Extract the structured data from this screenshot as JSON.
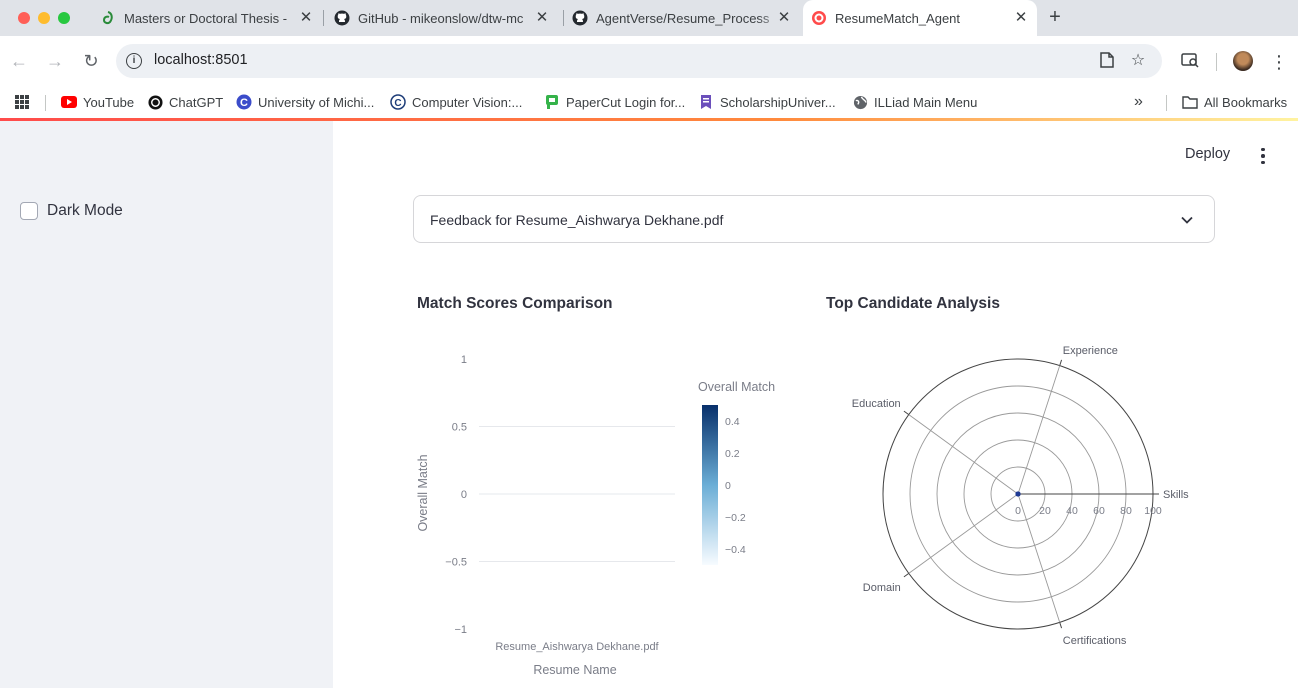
{
  "browser": {
    "tabs": [
      {
        "title": "Masters or Doctoral Thesis - ",
        "icon": "overleaf-icon",
        "active": false
      },
      {
        "title": "GitHub - mikeonslow/dtw-mc",
        "icon": "github-icon",
        "active": false
      },
      {
        "title": "AgentVerse/Resume_Process",
        "icon": "github-icon",
        "active": false
      },
      {
        "title": "ResumeMatch_Agent",
        "icon": "streamlit-icon",
        "active": true
      }
    ],
    "url": "localhost:8501",
    "bookmarks": [
      {
        "label": "YouTube",
        "icon": "youtube-icon"
      },
      {
        "label": "ChatGPT",
        "icon": "chatgpt-icon"
      },
      {
        "label": "University of Michi...",
        "icon": "umich-icon"
      },
      {
        "label": "Computer Vision:...",
        "icon": "cv-icon"
      },
      {
        "label": "PaperCut Login for...",
        "icon": "papercut-icon"
      },
      {
        "label": "ScholarshipUniver...",
        "icon": "scholarship-icon"
      },
      {
        "label": "ILLiad Main Menu",
        "icon": "globe-icon"
      }
    ],
    "all_bookmarks": "All Bookmarks",
    "chevron_more": "»"
  },
  "sidebar": {
    "dark_mode_label": "Dark Mode",
    "dark_mode_checked": false
  },
  "header": {
    "deploy_label": "Deploy"
  },
  "expander": {
    "label": "Feedback for Resume_Aishwarya Dekhane.pdf"
  },
  "bar_chart_title": "Match Scores Comparison",
  "radar_chart_title": "Top Candidate Analysis",
  "colors": {
    "accent": "#ff4b4b",
    "text": "#31333f",
    "sidebar_bg": "#f0f2f6",
    "colorscale_low": "#f7fbff",
    "colorscale_mid": "#6baed6",
    "colorscale_high": "#08306b",
    "radar_point": "#1f3a93"
  },
  "chart_data": [
    {
      "type": "bar",
      "categories": [
        "Resume_Aishwarya Dekhane.pdf"
      ],
      "values": [
        0
      ],
      "xlabel": "Resume Name",
      "ylabel": "Overall Match",
      "ylim": [
        -1,
        1
      ],
      "yticks": [
        "1",
        "0.5",
        "0",
        "−0.5",
        "−1"
      ],
      "ytick_values": [
        1,
        0.5,
        0,
        -0.5,
        -1
      ],
      "colorbar": {
        "title": "Overall Match",
        "ticks": [
          "0.4",
          "0.2",
          "0",
          "−0.2",
          "−0.4"
        ],
        "tick_values": [
          0.4,
          0.2,
          0,
          -0.2,
          -0.4
        ],
        "range": [
          -0.5,
          0.5
        ]
      },
      "grid": true
    },
    {
      "type": "radar",
      "axes": [
        "Skills",
        "Experience",
        "Education",
        "Domain",
        "Certifications"
      ],
      "values": [
        0,
        0,
        0,
        0,
        0
      ],
      "radial_ticks": [
        "0",
        "20",
        "40",
        "60",
        "80",
        "100"
      ],
      "radial_tick_values": [
        0,
        20,
        40,
        60,
        80,
        100
      ],
      "range": [
        0,
        100
      ]
    }
  ]
}
